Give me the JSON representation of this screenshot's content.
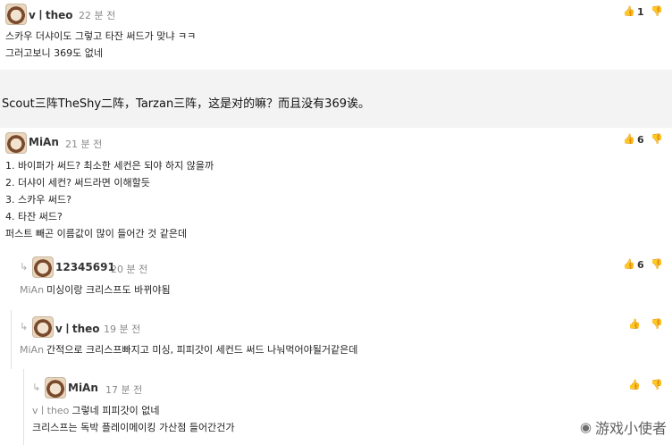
{
  "comments": [
    {
      "username": "vㅣtheo",
      "timestamp": "22 분 전",
      "likes": "1",
      "lines": [
        "스카우 더샤이도 그렇고 타잔 써드가 맞냐 ㅋㅋ",
        "그러고보니 369도 없네"
      ]
    },
    {
      "username": "MiAn",
      "timestamp": "21 분 전",
      "likes": "6",
      "lines": [
        "1. 바이퍼가 써드? 최소한 세컨은 되야 하지 않을까",
        "2. 더샤이 세컨? 써드라면 이해할듯",
        "3. 스카우 써드?",
        "4. 타잔 써드?",
        "퍼스트 빼곤 이름값이 많이 들어간 것 같은데"
      ]
    }
  ],
  "caption": "Scout三阵TheShy二阵，Tarzan三阵，这是对的嘛？而且没有369诶。",
  "replies": [
    {
      "username": "12345691",
      "timestamp": "20 분 전",
      "likes": "6",
      "mention": "MiAn",
      "lines": [
        "미싱이랑 크리스프도 바뀌야됨"
      ]
    },
    {
      "username": "vㅣtheo",
      "timestamp": "19 분 전",
      "likes": "",
      "mention": "MiAn",
      "lines": [
        "간적으로 크리스프빠지고 미싱, 피피갓이 세컨드 써드 나눠먹어야될거같은데"
      ]
    },
    {
      "username": "MiAn",
      "timestamp": "17 분 전",
      "likes": "",
      "mention": "vㅣtheo",
      "lines": [
        "그렇네 피피갓이 없네",
        "크리스프는 독박 플레이메이킹 가산점 들어간건가"
      ]
    }
  ],
  "watermark": "游戏小使者",
  "icons": {
    "reply_arrow": "↳",
    "thumb_up": "👍",
    "thumb_down": "👎"
  }
}
